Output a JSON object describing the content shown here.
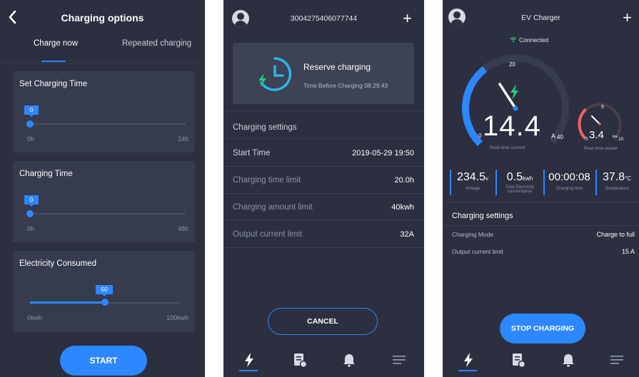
{
  "colors": {
    "background": "#2b2f3f",
    "card": "#363b4e",
    "accent": "#2d87ff",
    "green": "#25d07e",
    "red": "#f0626a"
  },
  "screen1": {
    "title": "Charging options",
    "back_icon": "chevron-left-icon",
    "tabs": [
      {
        "label": "Charge now",
        "active": true
      },
      {
        "label": "Repeated charging",
        "active": false
      }
    ],
    "cards": [
      {
        "title": "Set Charging Time",
        "value": "0",
        "min_label": "0h",
        "max_label": "24h",
        "fraction": 0
      },
      {
        "title": "Charging Time",
        "value": "0",
        "min_label": "0h",
        "max_label": "48h",
        "fraction": 0
      },
      {
        "title": "Electricity Consumed",
        "value": "50",
        "min_label": "0kwh",
        "max_label": "100kwh",
        "fraction": 0.5
      }
    ],
    "start_label": "START"
  },
  "screen2": {
    "title": "3004275406077744",
    "reserve": {
      "title": "Reserve charging",
      "time_text": "Time Before Charging 08:29:43",
      "icon": "clock-bolt-icon"
    },
    "section_title": "Charging settings",
    "rows": [
      {
        "label": "Start Time",
        "value": "2019-05-29 19:50"
      },
      {
        "label": "Charging time limit",
        "value": "20.0h"
      },
      {
        "label": "Charging amount limit",
        "value": "40kwh"
      },
      {
        "label": "Output current limit",
        "value": "32A"
      }
    ],
    "cancel_label": "CANCEL",
    "nav_icons": [
      "bolt-icon",
      "document-icon",
      "bell-icon",
      "menu-icon"
    ]
  },
  "screen3": {
    "title": "EV Charger",
    "status": "Connected",
    "current_gauge": {
      "value": "14.4",
      "unit": "A",
      "min": "0",
      "mid": "20",
      "max": "40",
      "caption": "Real-time current",
      "fraction": 0.36
    },
    "power_gauge": {
      "value": "3.4",
      "unit": "kw",
      "min": "0",
      "mid": "5",
      "max": "10",
      "caption": "Real-time power",
      "fraction": 0.34
    },
    "metrics": [
      {
        "value": "234.5",
        "unit": "v",
        "label": "Voltage"
      },
      {
        "value": "0.5",
        "unit": "kwh",
        "label": "Total Electricity consumption"
      },
      {
        "value": "00:00:08",
        "unit": "",
        "label": "Charging time"
      },
      {
        "value": "37.8",
        "unit": "°C",
        "label": "Temperature"
      }
    ],
    "section_title": "Charging settings",
    "rows": [
      {
        "label": "Charging Mode",
        "value": "Charge to full"
      },
      {
        "label": "Output current limit",
        "value": "15 A"
      }
    ],
    "stop_label": "STOP CHARGING",
    "nav_icons": [
      "bolt-icon",
      "document-icon",
      "bell-icon",
      "menu-icon"
    ]
  }
}
